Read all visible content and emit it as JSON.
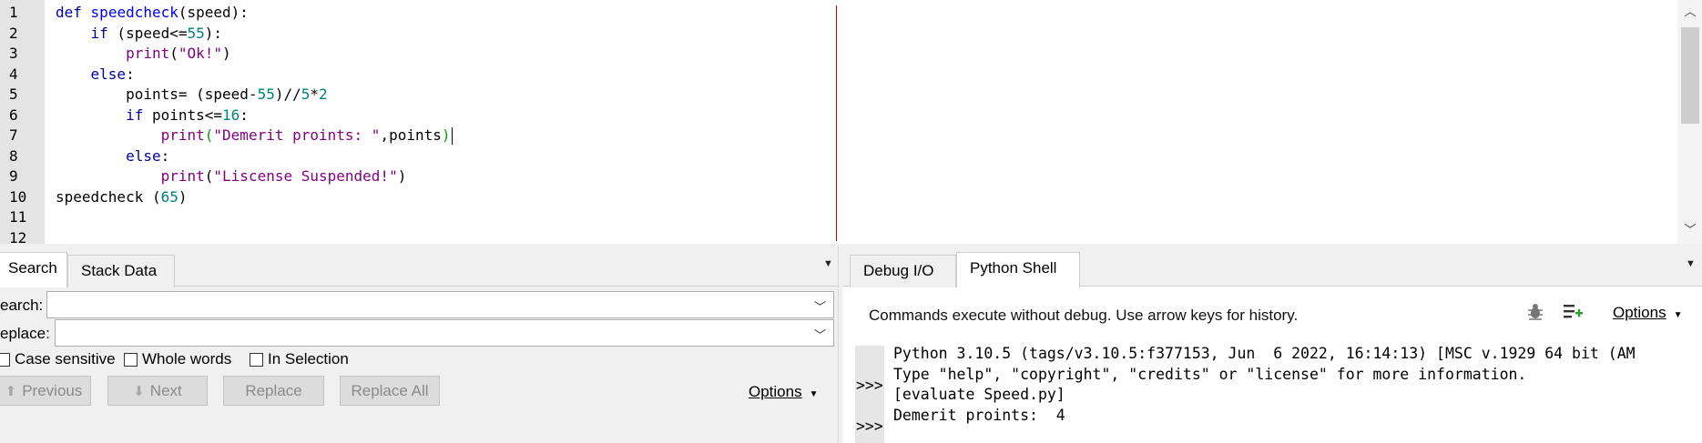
{
  "editor": {
    "line_numbers": [
      "1",
      "2",
      "3",
      "4",
      "5",
      "6",
      "7",
      "8",
      "9",
      "10",
      "11",
      "12"
    ],
    "code": {
      "l1": {
        "kw": "def",
        "sp": " ",
        "fn": "speedcheck",
        "rest": "(speed):"
      },
      "l2": {
        "indent": "    ",
        "kw": "if",
        "a": " (speed<=",
        "n": "55",
        "b": "):"
      },
      "l3": {
        "indent": "        ",
        "bi": "print",
        "a": "(",
        "s": "\"Ok!\"",
        "b": ")"
      },
      "l4": {
        "indent": "    ",
        "kw": "else",
        "b": ":"
      },
      "l5": {
        "indent": "        ",
        "a": "points= (speed-",
        "n1": "55",
        "b": ")//",
        "n2": "5",
        "c": "*",
        "n3": "2"
      },
      "l6": {
        "indent": "        ",
        "kw": "if",
        "a": " points<=",
        "n": "16",
        "b": ":"
      },
      "l7": {
        "indent": "            ",
        "bi": "print",
        "p": "(",
        "s": "\"Demerit proints: \"",
        "a": ",points",
        "q": ")"
      },
      "l8": {
        "indent": "        ",
        "kw": "else",
        "b": ":"
      },
      "l9": {
        "indent": "            ",
        "bi": "print",
        "a": "(",
        "s": "\"Liscense Suspended!\"",
        "b": ")"
      },
      "l10": {
        "a": "speedcheck (",
        "n": "65",
        "b": ")"
      }
    }
  },
  "search_panel": {
    "tabs": [
      "Search",
      "Stack Data"
    ],
    "search_label": "earch:",
    "replace_label": "eplace:",
    "search_value": "",
    "replace_value": "",
    "checkboxes": {
      "case_sensitive": "Case sensitive",
      "whole_words": "Whole words",
      "in_selection": "In Selection"
    },
    "buttons": {
      "previous": "Previous",
      "next": "Next",
      "replace": "Replace",
      "replace_all": "Replace All"
    },
    "options_label": "Options"
  },
  "shell_panel": {
    "tabs": [
      "Debug I/O",
      "Python Shell"
    ],
    "info": "Commands execute without debug.  Use arrow keys for history.",
    "options_label": "Options",
    "prompt": ">>>",
    "output_lines": [
      "Python 3.10.5 (tags/v3.10.5:f377153, Jun  6 2022, 16:14:13) [MSC v.1929 64 bit (AM",
      "Type \"help\", \"copyright\", \"credits\" or \"license\" for more information.",
      "[evaluate Speed.py]",
      "Demerit proints:  4"
    ]
  },
  "icons": {
    "debug": "bug-icon",
    "add_line": "list-add-icon",
    "up": "chevron-up-icon",
    "down": "chevron-down-icon"
  }
}
